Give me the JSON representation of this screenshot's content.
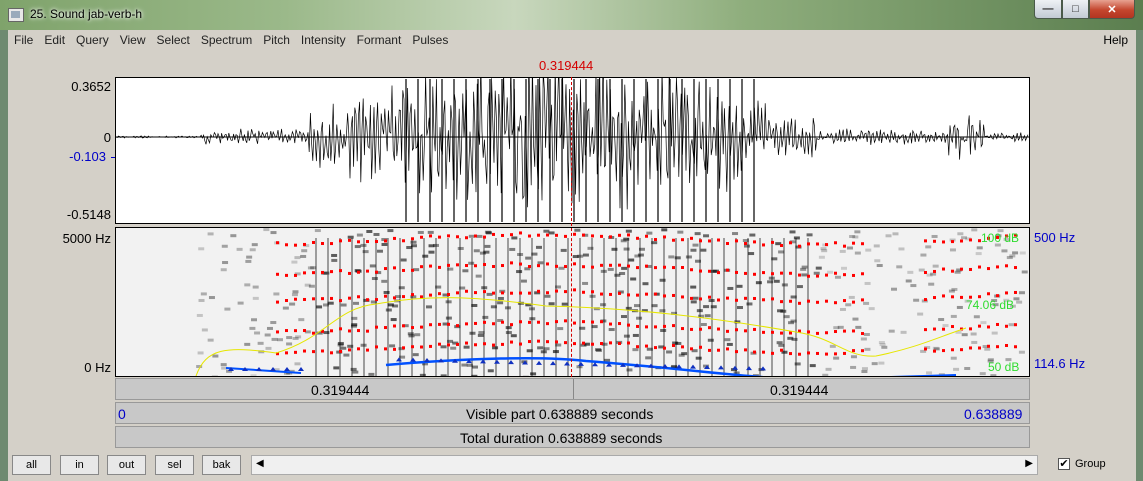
{
  "window": {
    "title": "25. Sound jab-verb-h",
    "min": "—",
    "max": "□",
    "close": "✕"
  },
  "menu": [
    "File",
    "Edit",
    "Query",
    "View",
    "Select",
    "Spectrum",
    "Pitch",
    "Intensity",
    "Formant",
    "Pulses"
  ],
  "help": "Help",
  "cursor": {
    "time": "0.319444"
  },
  "waveform": {
    "y_top": "0.3652",
    "y_zero": "0",
    "y_cursor": "-0.103",
    "y_bottom": "-0.5148"
  },
  "spectrogram": {
    "y_top": "5000 Hz",
    "y_bottom": "0 Hz",
    "right_top": "500 Hz",
    "right_bottom": "114.6 Hz",
    "intensity_top": "100 dB",
    "intensity_mid": "74.06 dB",
    "intensity_bottom": "50 dB"
  },
  "time_bar": {
    "left": "0.319444",
    "right": "0.319444"
  },
  "visible_bar": {
    "start": "0",
    "label": "Visible part 0.638889 seconds",
    "end": "0.638889"
  },
  "total_bar": {
    "label": "Total duration 0.638889 seconds"
  },
  "buttons": {
    "all": "all",
    "in": "in",
    "out": "out",
    "sel": "sel",
    "bak": "bak"
  },
  "scroll": {
    "left": "◀",
    "right": "▶"
  },
  "group": {
    "checked": "✔",
    "label": "Group"
  },
  "colors": {
    "cursor": "#d40000",
    "pitch": "#0050ff",
    "formant": "#ff0000",
    "intensity": "#e6e600",
    "label_blue": "#0000c8"
  }
}
